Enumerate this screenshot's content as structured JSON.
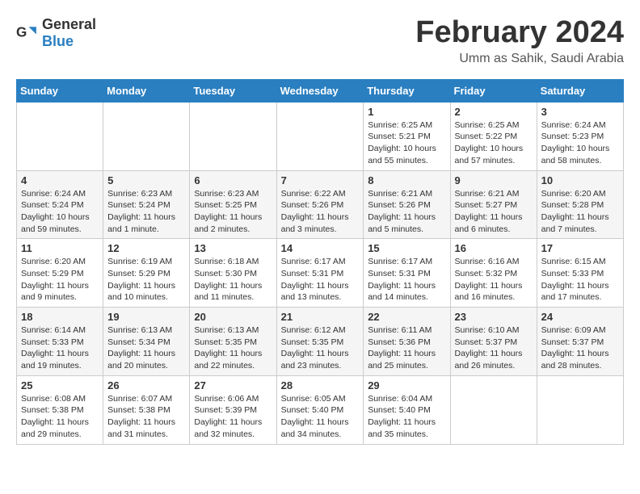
{
  "logo": {
    "general": "General",
    "blue": "Blue"
  },
  "header": {
    "month": "February 2024",
    "location": "Umm as Sahik, Saudi Arabia"
  },
  "weekdays": [
    "Sunday",
    "Monday",
    "Tuesday",
    "Wednesday",
    "Thursday",
    "Friday",
    "Saturday"
  ],
  "weeks": [
    [
      {
        "day": "",
        "sunrise": "",
        "sunset": "",
        "daylight": ""
      },
      {
        "day": "",
        "sunrise": "",
        "sunset": "",
        "daylight": ""
      },
      {
        "day": "",
        "sunrise": "",
        "sunset": "",
        "daylight": ""
      },
      {
        "day": "",
        "sunrise": "",
        "sunset": "",
        "daylight": ""
      },
      {
        "day": "1",
        "sunrise": "6:25 AM",
        "sunset": "5:21 PM",
        "daylight": "10 hours and 55 minutes."
      },
      {
        "day": "2",
        "sunrise": "6:25 AM",
        "sunset": "5:22 PM",
        "daylight": "10 hours and 57 minutes."
      },
      {
        "day": "3",
        "sunrise": "6:24 AM",
        "sunset": "5:23 PM",
        "daylight": "10 hours and 58 minutes."
      }
    ],
    [
      {
        "day": "4",
        "sunrise": "6:24 AM",
        "sunset": "5:24 PM",
        "daylight": "10 hours and 59 minutes."
      },
      {
        "day": "5",
        "sunrise": "6:23 AM",
        "sunset": "5:24 PM",
        "daylight": "11 hours and 1 minute."
      },
      {
        "day": "6",
        "sunrise": "6:23 AM",
        "sunset": "5:25 PM",
        "daylight": "11 hours and 2 minutes."
      },
      {
        "day": "7",
        "sunrise": "6:22 AM",
        "sunset": "5:26 PM",
        "daylight": "11 hours and 3 minutes."
      },
      {
        "day": "8",
        "sunrise": "6:21 AM",
        "sunset": "5:26 PM",
        "daylight": "11 hours and 5 minutes."
      },
      {
        "day": "9",
        "sunrise": "6:21 AM",
        "sunset": "5:27 PM",
        "daylight": "11 hours and 6 minutes."
      },
      {
        "day": "10",
        "sunrise": "6:20 AM",
        "sunset": "5:28 PM",
        "daylight": "11 hours and 7 minutes."
      }
    ],
    [
      {
        "day": "11",
        "sunrise": "6:20 AM",
        "sunset": "5:29 PM",
        "daylight": "11 hours and 9 minutes."
      },
      {
        "day": "12",
        "sunrise": "6:19 AM",
        "sunset": "5:29 PM",
        "daylight": "11 hours and 10 minutes."
      },
      {
        "day": "13",
        "sunrise": "6:18 AM",
        "sunset": "5:30 PM",
        "daylight": "11 hours and 11 minutes."
      },
      {
        "day": "14",
        "sunrise": "6:17 AM",
        "sunset": "5:31 PM",
        "daylight": "11 hours and 13 minutes."
      },
      {
        "day": "15",
        "sunrise": "6:17 AM",
        "sunset": "5:31 PM",
        "daylight": "11 hours and 14 minutes."
      },
      {
        "day": "16",
        "sunrise": "6:16 AM",
        "sunset": "5:32 PM",
        "daylight": "11 hours and 16 minutes."
      },
      {
        "day": "17",
        "sunrise": "6:15 AM",
        "sunset": "5:33 PM",
        "daylight": "11 hours and 17 minutes."
      }
    ],
    [
      {
        "day": "18",
        "sunrise": "6:14 AM",
        "sunset": "5:33 PM",
        "daylight": "11 hours and 19 minutes."
      },
      {
        "day": "19",
        "sunrise": "6:13 AM",
        "sunset": "5:34 PM",
        "daylight": "11 hours and 20 minutes."
      },
      {
        "day": "20",
        "sunrise": "6:13 AM",
        "sunset": "5:35 PM",
        "daylight": "11 hours and 22 minutes."
      },
      {
        "day": "21",
        "sunrise": "6:12 AM",
        "sunset": "5:35 PM",
        "daylight": "11 hours and 23 minutes."
      },
      {
        "day": "22",
        "sunrise": "6:11 AM",
        "sunset": "5:36 PM",
        "daylight": "11 hours and 25 minutes."
      },
      {
        "day": "23",
        "sunrise": "6:10 AM",
        "sunset": "5:37 PM",
        "daylight": "11 hours and 26 minutes."
      },
      {
        "day": "24",
        "sunrise": "6:09 AM",
        "sunset": "5:37 PM",
        "daylight": "11 hours and 28 minutes."
      }
    ],
    [
      {
        "day": "25",
        "sunrise": "6:08 AM",
        "sunset": "5:38 PM",
        "daylight": "11 hours and 29 minutes."
      },
      {
        "day": "26",
        "sunrise": "6:07 AM",
        "sunset": "5:38 PM",
        "daylight": "11 hours and 31 minutes."
      },
      {
        "day": "27",
        "sunrise": "6:06 AM",
        "sunset": "5:39 PM",
        "daylight": "11 hours and 32 minutes."
      },
      {
        "day": "28",
        "sunrise": "6:05 AM",
        "sunset": "5:40 PM",
        "daylight": "11 hours and 34 minutes."
      },
      {
        "day": "29",
        "sunrise": "6:04 AM",
        "sunset": "5:40 PM",
        "daylight": "11 hours and 35 minutes."
      },
      {
        "day": "",
        "sunrise": "",
        "sunset": "",
        "daylight": ""
      },
      {
        "day": "",
        "sunrise": "",
        "sunset": "",
        "daylight": ""
      }
    ]
  ],
  "labels": {
    "sunrise": "Sunrise:",
    "sunset": "Sunset:",
    "daylight": "Daylight:"
  }
}
